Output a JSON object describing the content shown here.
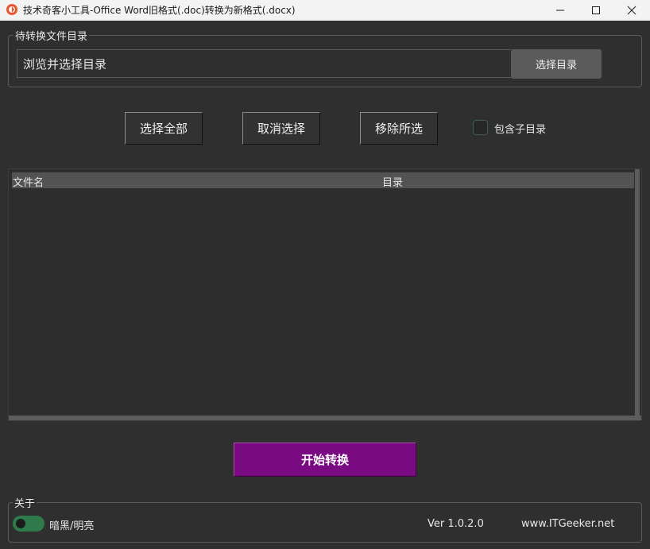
{
  "window": {
    "title": "技术奇客小工具-Office Word旧格式(.doc)转换为新格式(.docx)",
    "icon": "app-logo-icon",
    "controls": [
      "minimize-icon",
      "maximize-icon",
      "close-icon"
    ]
  },
  "directory": {
    "group_title": "待转换文件目录",
    "input_placeholder": "浏览并选择目录",
    "browse_button": "选择目录"
  },
  "actions": {
    "select_all": "选择全部",
    "deselect": "取消选择",
    "remove_selected": "移除所选",
    "include_subdirs_label": "包含子目录",
    "include_subdirs_checked": false
  },
  "file_table": {
    "columns": [
      "文件名",
      "目录"
    ],
    "rows": []
  },
  "start_button": "开始转换",
  "about": {
    "group_title": "关于",
    "theme_toggle_label": "暗黑/明亮",
    "version": "Ver 1.0.2.0",
    "website": "www.ITGeeker.net"
  },
  "colors": {
    "background": "#2f2f2f",
    "accent_purple": "#7a0a82",
    "toggle_green": "#2e7a4a",
    "button_gray": "#5b5b5b"
  }
}
